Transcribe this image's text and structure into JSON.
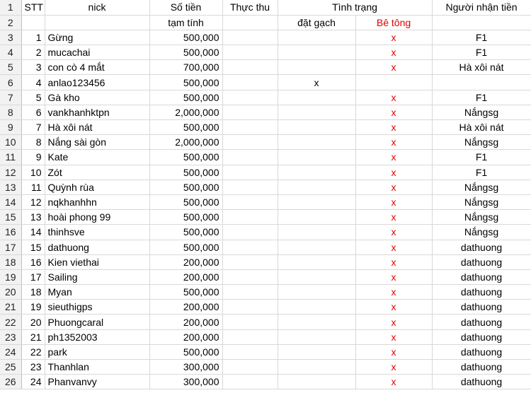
{
  "header": {
    "row1": {
      "num": "1",
      "stt": "STT",
      "nick": "nick",
      "so_tien": "Số tiền",
      "thuc_thu": "Thực thu",
      "tinh_trang": "Tình trạng",
      "nguoi_nhan": "Người nhận tiền"
    },
    "row2": {
      "num": "2",
      "so_tien_sub": "tạm tính",
      "dat_gach": "đặt gạch",
      "be_tong": "Bê tông"
    }
  },
  "rows": [
    {
      "num": "3",
      "stt": "1",
      "nick": "Gừng",
      "amount": "500,000",
      "dat": "",
      "bt": "x",
      "recv": "F1"
    },
    {
      "num": "4",
      "stt": "2",
      "nick": "mucachai",
      "amount": "500,000",
      "dat": "",
      "bt": "x",
      "recv": "F1"
    },
    {
      "num": "5",
      "stt": "3",
      "nick": "con cò 4 mắt",
      "amount": "700,000",
      "dat": "",
      "bt": "x",
      "recv": "Hà xôi nát"
    },
    {
      "num": "6",
      "stt": "4",
      "nick": "anlao123456",
      "amount": "500,000",
      "dat": "x",
      "bt": "",
      "recv": ""
    },
    {
      "num": "7",
      "stt": "5",
      "nick": "Gà kho",
      "amount": "500,000",
      "dat": "",
      "bt": "x",
      "recv": "F1"
    },
    {
      "num": "8",
      "stt": "6",
      "nick": "vankhanhktpn",
      "amount": "2,000,000",
      "dat": "",
      "bt": "x",
      "recv": "Nắngsg"
    },
    {
      "num": "9",
      "stt": "7",
      "nick": "Hà xôi nát",
      "amount": "500,000",
      "dat": "",
      "bt": "x",
      "recv": "Hà xôi nát"
    },
    {
      "num": "10",
      "stt": "8",
      "nick": "Nắng sài gòn",
      "amount": "2,000,000",
      "dat": "",
      "bt": "x",
      "recv": "Nắngsg"
    },
    {
      "num": "11",
      "stt": "9",
      "nick": "Kate",
      "amount": "500,000",
      "dat": "",
      "bt": "x",
      "recv": "F1"
    },
    {
      "num": "12",
      "stt": "10",
      "nick": "Zót",
      "amount": "500,000",
      "dat": "",
      "bt": "x",
      "recv": "F1"
    },
    {
      "num": "13",
      "stt": "11",
      "nick": "Quỳnh rùa",
      "amount": "500,000",
      "dat": "",
      "bt": "x",
      "recv": "Nắngsg"
    },
    {
      "num": "14",
      "stt": "12",
      "nick": "nqkhanhhn",
      "amount": "500,000",
      "dat": "",
      "bt": "x",
      "recv": "Nắngsg"
    },
    {
      "num": "15",
      "stt": "13",
      "nick": "hoài phong 99",
      "amount": "500,000",
      "dat": "",
      "bt": "x",
      "recv": "Nắngsg"
    },
    {
      "num": "16",
      "stt": "14",
      "nick": "thinhsve",
      "amount": "500,000",
      "dat": "",
      "bt": "x",
      "recv": "Nắngsg"
    },
    {
      "num": "17",
      "stt": "15",
      "nick": "dathuong",
      "amount": "500,000",
      "dat": "",
      "bt": "x",
      "recv": "dathuong"
    },
    {
      "num": "18",
      "stt": "16",
      "nick": "Kien viethai",
      "amount": "200,000",
      "dat": "",
      "bt": "x",
      "recv": "dathuong"
    },
    {
      "num": "19",
      "stt": "17",
      "nick": "Sailing",
      "amount": "200,000",
      "dat": "",
      "bt": "x",
      "recv": "dathuong"
    },
    {
      "num": "20",
      "stt": "18",
      "nick": "Myan",
      "amount": "500,000",
      "dat": "",
      "bt": "x",
      "recv": "dathuong"
    },
    {
      "num": "21",
      "stt": "19",
      "nick": "sieuthigps",
      "amount": "200,000",
      "dat": "",
      "bt": "x",
      "recv": "dathuong"
    },
    {
      "num": "22",
      "stt": "20",
      "nick": "Phuongcaral",
      "amount": "200,000",
      "dat": "",
      "bt": "x",
      "recv": "dathuong"
    },
    {
      "num": "23",
      "stt": "21",
      "nick": "ph1352003",
      "amount": "200,000",
      "dat": "",
      "bt": "x",
      "recv": "dathuong"
    },
    {
      "num": "24",
      "stt": "22",
      "nick": "park",
      "amount": "500,000",
      "dat": "",
      "bt": "x",
      "recv": "dathuong"
    },
    {
      "num": "25",
      "stt": "23",
      "nick": "Thanhlan",
      "amount": "300,000",
      "dat": "",
      "bt": "x",
      "recv": "dathuong"
    },
    {
      "num": "26",
      "stt": "24",
      "nick": "Phanvanvy",
      "amount": "300,000",
      "dat": "",
      "bt": "x",
      "recv": "dathuong"
    }
  ],
  "colors": {
    "red_mark": "#e00000",
    "row_header_bg": "#f2f2f2",
    "grid": "#d9d9d9"
  }
}
